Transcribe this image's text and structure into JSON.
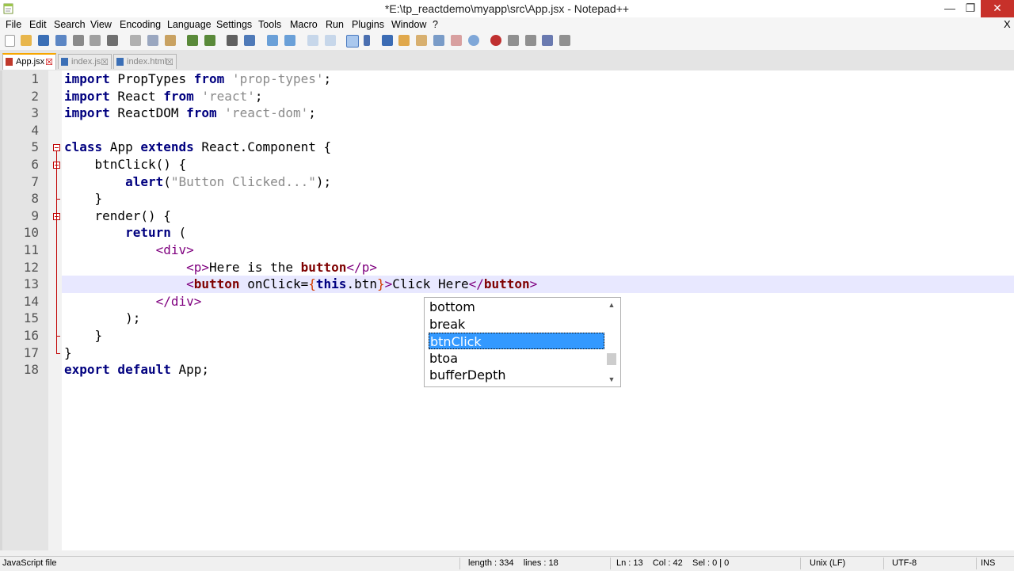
{
  "window": {
    "title": "*E:\\tp_reactdemo\\myapp\\src\\App.jsx - Notepad++",
    "minimize": "—",
    "maximize": "❐",
    "close": "✕"
  },
  "menu": {
    "items": [
      "File",
      "Edit",
      "Search",
      "View",
      "Encoding",
      "Language",
      "Settings",
      "Tools",
      "Macro",
      "Run",
      "Plugins",
      "Window",
      "?"
    ],
    "close": "X"
  },
  "tabs": [
    {
      "label": "App.jsx",
      "active": true
    },
    {
      "label": "index.js",
      "active": false
    },
    {
      "label": "index.html",
      "active": false
    }
  ],
  "editor": {
    "line_numbers": [
      "1",
      "2",
      "3",
      "4",
      "5",
      "6",
      "7",
      "8",
      "9",
      "10",
      "11",
      "12",
      "13",
      "14",
      "15",
      "16",
      "17",
      "18"
    ],
    "current_line": 13
  },
  "autocomplete": {
    "items": [
      "bottom",
      "break",
      "btnClick",
      "btoa",
      "bufferDepth"
    ],
    "selected_index": 2
  },
  "status": {
    "file_type": "JavaScript file",
    "length_lines": "length : 334    lines : 18",
    "position": "Ln : 13    Col : 42    Sel : 0 | 0",
    "eol": "Unix (LF)",
    "encoding": "UTF-8",
    "mode": "INS"
  },
  "colors": {
    "keyword": "#00007f",
    "string": "#8a8a8a",
    "tag": "#7f007f",
    "selection": "#3399ff",
    "current_line": "#e8e8ff",
    "close_button": "#c7312a"
  }
}
